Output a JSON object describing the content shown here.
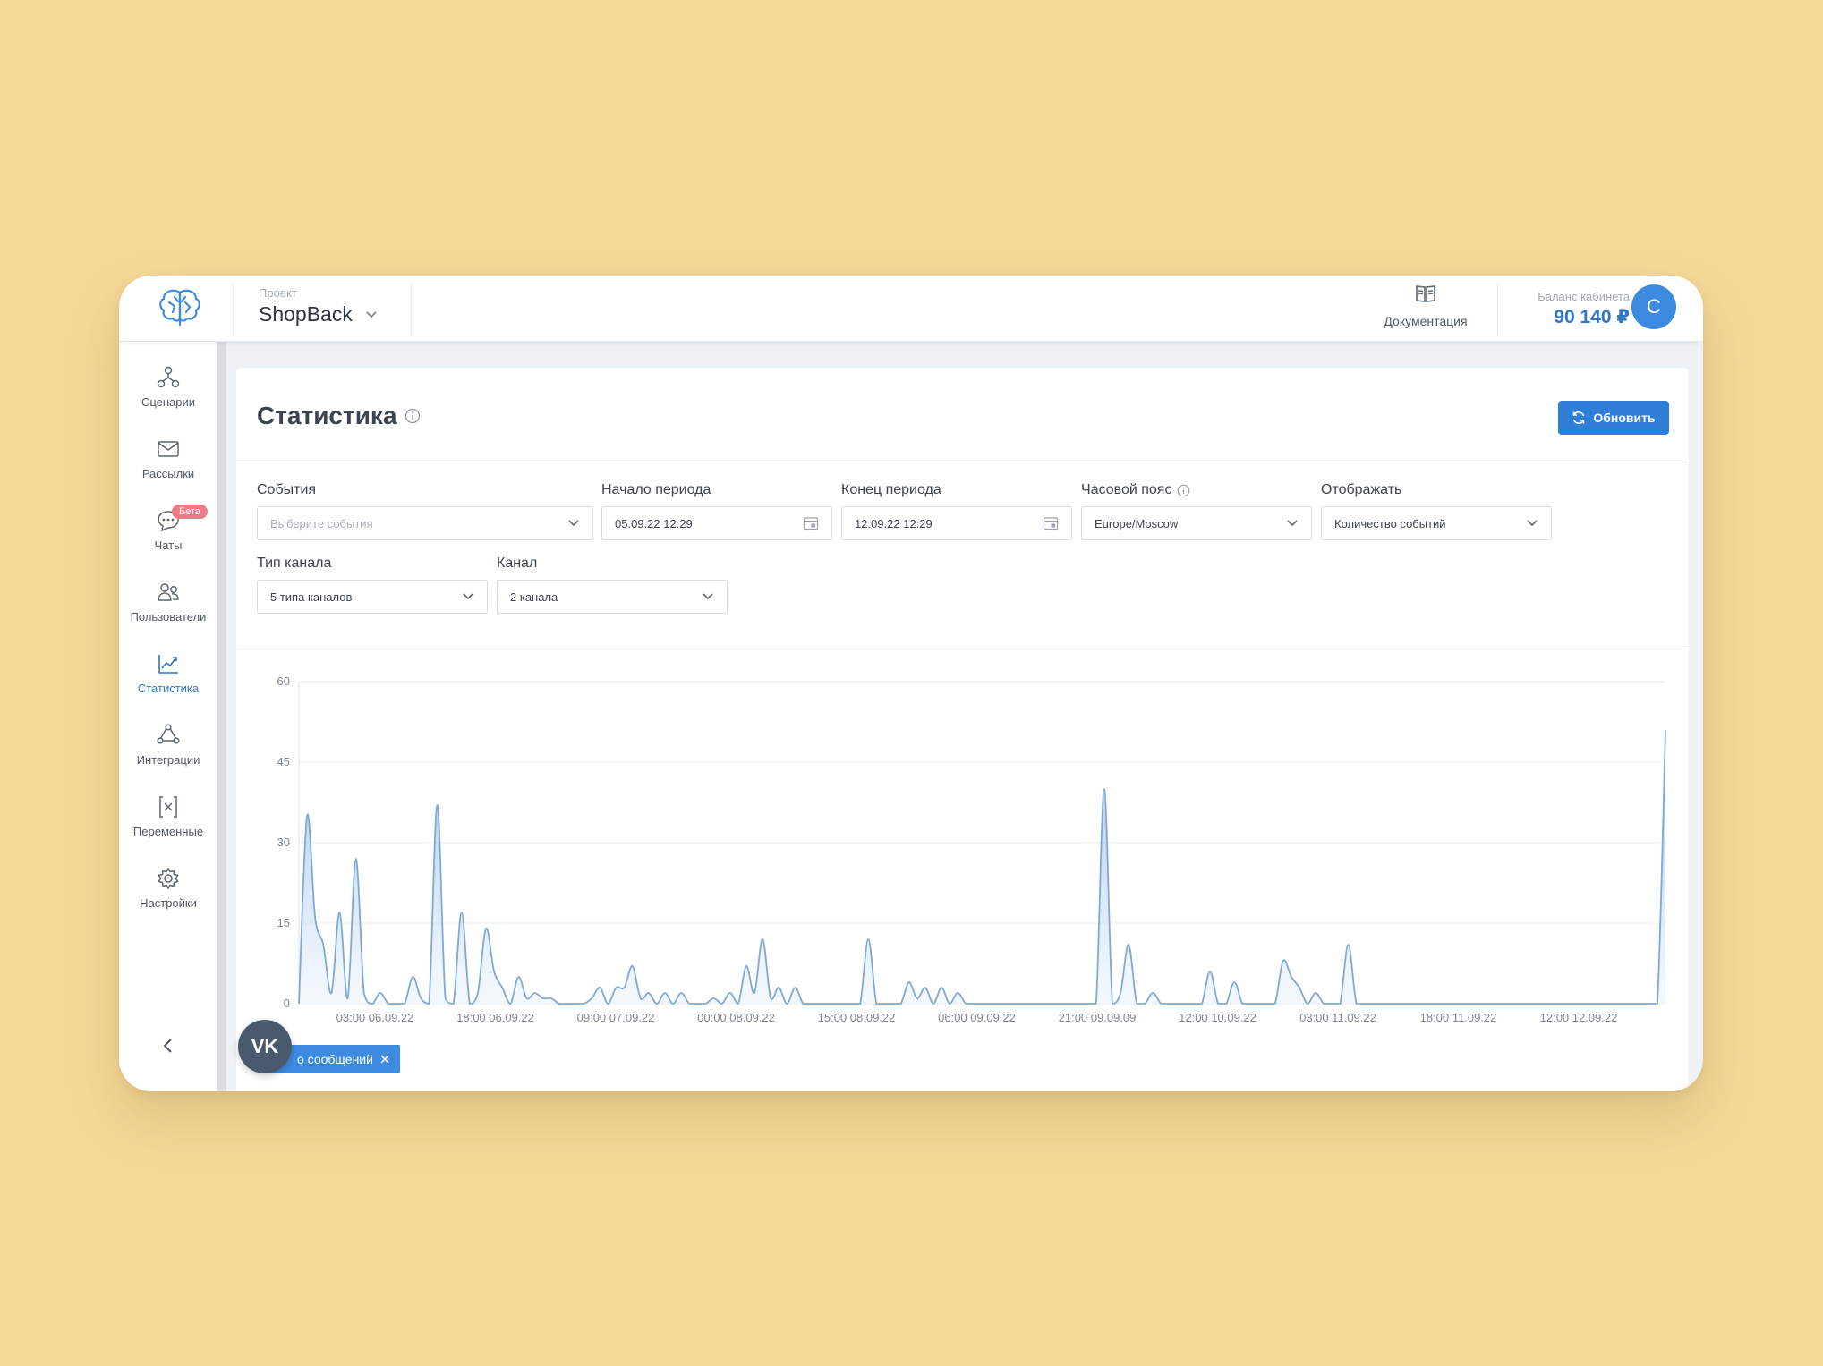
{
  "header": {
    "project_label": "Проект",
    "project_name": "ShopBack",
    "docs_label": "Документация",
    "balance_label": "Баланс кабинета",
    "balance_value": "90 140 ₽",
    "avatar_letter": "С"
  },
  "sidebar": {
    "items": [
      {
        "label": "Сценарии",
        "icon": "scenarios-icon"
      },
      {
        "label": "Рассылки",
        "icon": "mail-icon"
      },
      {
        "label": "Чаты",
        "icon": "chat-icon",
        "badge": "Бета"
      },
      {
        "label": "Пользователи",
        "icon": "users-icon"
      },
      {
        "label": "Статистика",
        "icon": "chart-icon",
        "active": true
      },
      {
        "label": "Интеграции",
        "icon": "integrations-icon"
      },
      {
        "label": "Переменные",
        "icon": "variables-icon"
      },
      {
        "label": "Настройки",
        "icon": "gear-icon"
      }
    ]
  },
  "page": {
    "title": "Статистика",
    "refresh_label": "Обновить"
  },
  "filters": {
    "events": {
      "label": "События",
      "placeholder": "Выберите события"
    },
    "period_start": {
      "label": "Начало периода",
      "value": "05.09.22 12:29"
    },
    "period_end": {
      "label": "Конец периода",
      "value": "12.09.22 12:29"
    },
    "timezone": {
      "label": "Часовой пояс",
      "value": "Europe/Moscow"
    },
    "display": {
      "label": "Отображать",
      "value": "Количество событий"
    },
    "channel_type": {
      "label": "Тип канала",
      "value": "5 типа каналов"
    },
    "channel": {
      "label": "Канал",
      "value": "2 канала"
    }
  },
  "chip": {
    "label": "о сообщений",
    "vk_text": "VK"
  },
  "colors": {
    "accent": "#2f7fd8",
    "line": "#7fa9d4",
    "fill": "#cfe0f3",
    "badge": "#f07a86"
  },
  "chart_data": {
    "type": "area",
    "ylim": [
      0,
      60
    ],
    "yticks": [
      0,
      15,
      30,
      45,
      60
    ],
    "x_tick_labels": [
      "03:00 06.09.22",
      "18:00 06.09.22",
      "09:00 07.09.22",
      "00:00 08.09.22",
      "15:00 08.09.22",
      "06:00 09.09.22",
      "21:00 09.09.09",
      "12:00 10.09.22",
      "03:00 11.09.22",
      "18:00 11.09.22",
      "12:00 12.09.22"
    ],
    "x": [
      0,
      1,
      2,
      3,
      4,
      5,
      6,
      7,
      8,
      9,
      10,
      11,
      12,
      13,
      14,
      15,
      16,
      17,
      18,
      19,
      20,
      21,
      22,
      23,
      24,
      25,
      26,
      27,
      28,
      29,
      30,
      31,
      32,
      33,
      34,
      35,
      36,
      37,
      38,
      39,
      40,
      41,
      42,
      43,
      44,
      45,
      46,
      47,
      48,
      49,
      50,
      51,
      52,
      53,
      54,
      55,
      56,
      57,
      58,
      59,
      60,
      61,
      62,
      63,
      64,
      65,
      66,
      67,
      68,
      69,
      70,
      71,
      72,
      73,
      74,
      75,
      76,
      77,
      78,
      79,
      80,
      81,
      82,
      83,
      84,
      85,
      86,
      87,
      88,
      89,
      90,
      91,
      92,
      93,
      94,
      95,
      96,
      97,
      98,
      99,
      100,
      101,
      102,
      103,
      104,
      105,
      106,
      107,
      108,
      109,
      110,
      111,
      112,
      113,
      114,
      115,
      116,
      117,
      118,
      119,
      120,
      121,
      122,
      123,
      124,
      125,
      126,
      127,
      128,
      129,
      130,
      131,
      132,
      133,
      134,
      135,
      136,
      137,
      138,
      139,
      140,
      141,
      142,
      143,
      144,
      145,
      146,
      147,
      148,
      149,
      150,
      151,
      152,
      153,
      154,
      155,
      156,
      157,
      158,
      159,
      160,
      161,
      162,
      163,
      164,
      165,
      166,
      167,
      168
    ],
    "values": [
      0,
      35,
      16,
      11,
      2,
      17,
      1,
      27,
      2,
      0,
      2,
      0,
      0,
      0,
      5,
      1,
      0,
      37,
      1,
      0,
      17,
      0,
      2,
      14,
      6,
      3,
      0,
      5,
      1,
      2,
      1,
      1,
      0,
      0,
      0,
      0,
      1,
      3,
      0,
      3,
      3,
      7,
      1,
      2,
      0,
      2,
      0,
      2,
      0,
      0,
      0,
      1,
      0,
      2,
      0,
      7,
      2,
      12,
      1,
      3,
      0,
      3,
      0,
      0,
      0,
      0,
      0,
      0,
      0,
      0,
      12,
      0,
      0,
      0,
      0,
      4,
      1,
      3,
      0,
      3,
      0,
      2,
      0,
      0,
      0,
      0,
      0,
      0,
      0,
      0,
      0,
      0,
      0,
      0,
      0,
      0,
      0,
      0,
      0,
      40,
      0,
      2,
      11,
      0,
      0,
      2,
      0,
      0,
      0,
      0,
      0,
      0,
      6,
      0,
      0,
      4,
      0,
      0,
      0,
      0,
      0,
      8,
      5,
      3,
      0,
      2,
      0,
      0,
      0,
      11,
      0,
      0,
      0,
      0,
      0,
      0,
      0,
      0,
      0,
      0,
      0,
      0,
      0,
      0,
      0,
      0,
      0,
      0,
      0,
      0,
      0,
      0,
      0,
      0,
      0,
      0,
      0,
      0,
      0,
      0,
      0,
      0,
      0,
      0,
      0,
      0,
      0,
      0,
      51
    ]
  }
}
